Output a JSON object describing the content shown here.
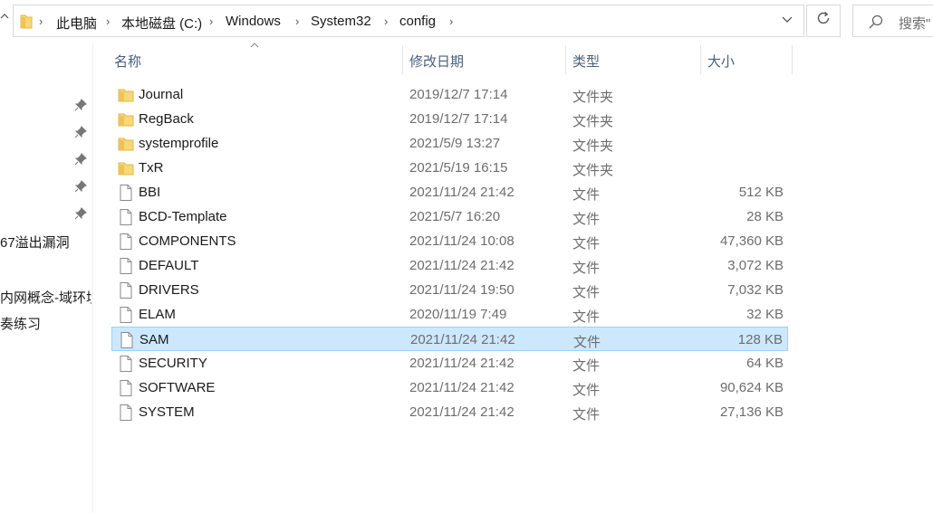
{
  "breadcrumb": [
    "此电脑",
    "本地磁盘 (C:)",
    "Windows",
    "System32",
    "config"
  ],
  "search": {
    "placeholder": "搜索\""
  },
  "nav": {
    "items": [
      {
        "label": "67溢出漏洞"
      },
      {
        "label": "内网概念-域环境"
      },
      {
        "label": "奏练习"
      }
    ]
  },
  "columns": {
    "name": "名称",
    "date": "修改日期",
    "type": "类型",
    "size": "大小"
  },
  "colors": {
    "selection": "#cce8ff",
    "selection_border": "#99d1ff",
    "folder": "#f8d775"
  },
  "files": [
    {
      "name": "Journal",
      "date": "2019/12/7 17:14",
      "type": "文件夹",
      "size": "",
      "icon": "folder-icon"
    },
    {
      "name": "RegBack",
      "date": "2019/12/7 17:14",
      "type": "文件夹",
      "size": "",
      "icon": "folder-icon"
    },
    {
      "name": "systemprofile",
      "date": "2021/5/9 13:27",
      "type": "文件夹",
      "size": "",
      "icon": "folder-icon"
    },
    {
      "name": "TxR",
      "date": "2021/5/19 16:15",
      "type": "文件夹",
      "size": "",
      "icon": "folder-icon"
    },
    {
      "name": "BBI",
      "date": "2021/11/24 21:42",
      "type": "文件",
      "size": "512 KB",
      "icon": "file-icon"
    },
    {
      "name": "BCD-Template",
      "date": "2021/5/7 16:20",
      "type": "文件",
      "size": "28 KB",
      "icon": "file-icon"
    },
    {
      "name": "COMPONENTS",
      "date": "2021/11/24 10:08",
      "type": "文件",
      "size": "47,360 KB",
      "icon": "file-icon"
    },
    {
      "name": "DEFAULT",
      "date": "2021/11/24 21:42",
      "type": "文件",
      "size": "3,072 KB",
      "icon": "file-icon"
    },
    {
      "name": "DRIVERS",
      "date": "2021/11/24 19:50",
      "type": "文件",
      "size": "7,032 KB",
      "icon": "file-icon"
    },
    {
      "name": "ELAM",
      "date": "2020/11/19 7:49",
      "type": "文件",
      "size": "32 KB",
      "icon": "file-icon"
    },
    {
      "name": "SAM",
      "date": "2021/11/24 21:42",
      "type": "文件",
      "size": "128 KB",
      "icon": "file-icon",
      "selected": true
    },
    {
      "name": "SECURITY",
      "date": "2021/11/24 21:42",
      "type": "文件",
      "size": "64 KB",
      "icon": "file-icon"
    },
    {
      "name": "SOFTWARE",
      "date": "2021/11/24 21:42",
      "type": "文件",
      "size": "90,624 KB",
      "icon": "file-icon"
    },
    {
      "name": "SYSTEM",
      "date": "2021/11/24 21:42",
      "type": "文件",
      "size": "27,136 KB",
      "icon": "file-icon"
    }
  ]
}
